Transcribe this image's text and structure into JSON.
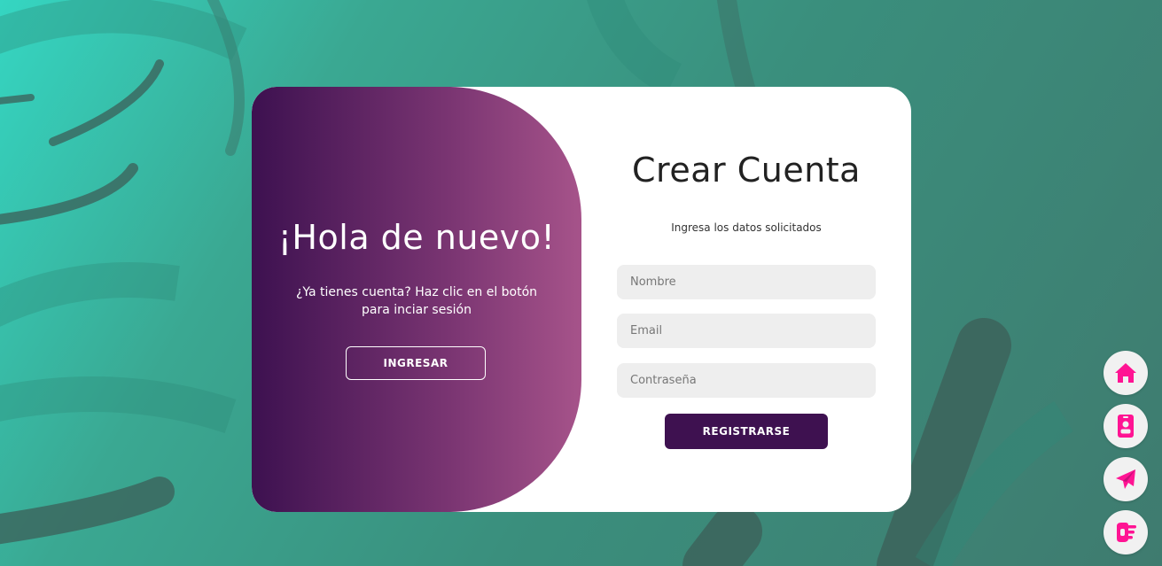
{
  "welcome_panel": {
    "title": "¡Hola de nuevo!",
    "message": "¿Ya tienes cuenta? Haz clic en el botón para inciar sesión",
    "login_button": "INGRESAR",
    "gradient": [
      "#3d1150",
      "#a6538a"
    ]
  },
  "register_form": {
    "title": "Crear Cuenta",
    "subtitle": "Ingresa los datos solicitados",
    "name_placeholder": "Nombre",
    "email_placeholder": "Email",
    "password_placeholder": "Contraseña",
    "submit_button": "REGISTRARSE",
    "button_color": "#3e1150"
  },
  "floating_nav": [
    {
      "icon": "home-icon"
    },
    {
      "icon": "id-card-icon"
    },
    {
      "icon": "paper-plane-icon"
    },
    {
      "icon": "hand-pointer-icon"
    }
  ],
  "colors": {
    "accent": "#ff1493",
    "background": "#3a8f7d"
  }
}
